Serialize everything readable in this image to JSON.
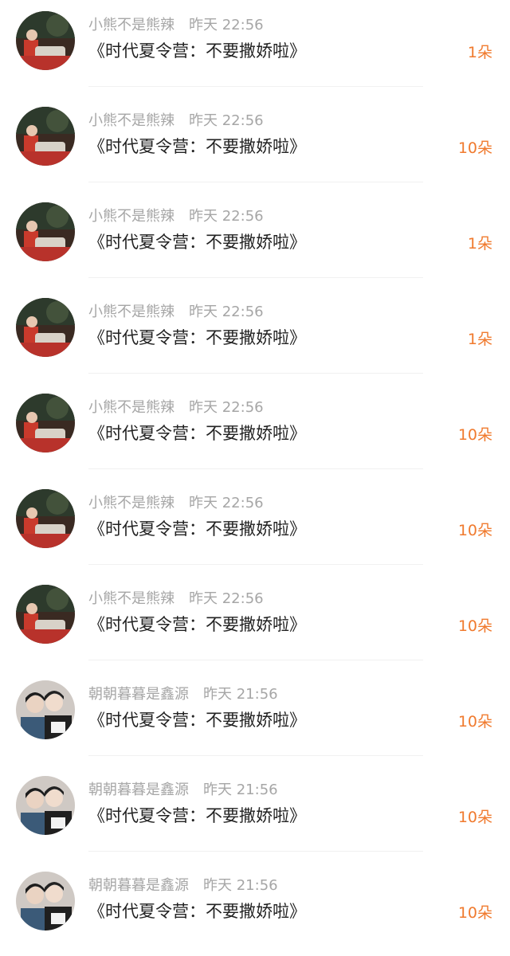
{
  "colors": {
    "username": "#a6a6a6",
    "title": "#222222",
    "count": "#f07a2e",
    "divider": "#f1f1f1",
    "background": "#ffffff"
  },
  "rows": [
    {
      "avatar": "avatar-red-photo",
      "username": "小熊不是熊辣",
      "time": "昨天 22:56",
      "title": "《时代夏令营：不要撒娇啦》",
      "count": "1朵"
    },
    {
      "avatar": "avatar-red-photo",
      "username": "小熊不是熊辣",
      "time": "昨天 22:56",
      "title": "《时代夏令营：不要撒娇啦》",
      "count": "10朵"
    },
    {
      "avatar": "avatar-red-photo",
      "username": "小熊不是熊辣",
      "time": "昨天 22:56",
      "title": "《时代夏令营：不要撒娇啦》",
      "count": "1朵"
    },
    {
      "avatar": "avatar-red-photo",
      "username": "小熊不是熊辣",
      "time": "昨天 22:56",
      "title": "《时代夏令营：不要撒娇啦》",
      "count": "1朵"
    },
    {
      "avatar": "avatar-red-photo",
      "username": "小熊不是熊辣",
      "time": "昨天 22:56",
      "title": "《时代夏令营：不要撒娇啦》",
      "count": "10朵"
    },
    {
      "avatar": "avatar-red-photo",
      "username": "小熊不是熊辣",
      "time": "昨天 22:56",
      "title": "《时代夏令营：不要撒娇啦》",
      "count": "10朵"
    },
    {
      "avatar": "avatar-red-photo",
      "username": "小熊不是熊辣",
      "time": "昨天 22:56",
      "title": "《时代夏令营：不要撒娇啦》",
      "count": "10朵"
    },
    {
      "avatar": "avatar-two-people-photo",
      "username": "朝朝暮暮是鑫源",
      "time": "昨天 21:56",
      "title": "《时代夏令营：不要撒娇啦》",
      "count": "10朵"
    },
    {
      "avatar": "avatar-two-people-photo",
      "username": "朝朝暮暮是鑫源",
      "time": "昨天 21:56",
      "title": "《时代夏令营：不要撒娇啦》",
      "count": "10朵"
    },
    {
      "avatar": "avatar-two-people-photo",
      "username": "朝朝暮暮是鑫源",
      "time": "昨天 21:56",
      "title": "《时代夏令营：不要撒娇啦》",
      "count": "10朵"
    }
  ]
}
